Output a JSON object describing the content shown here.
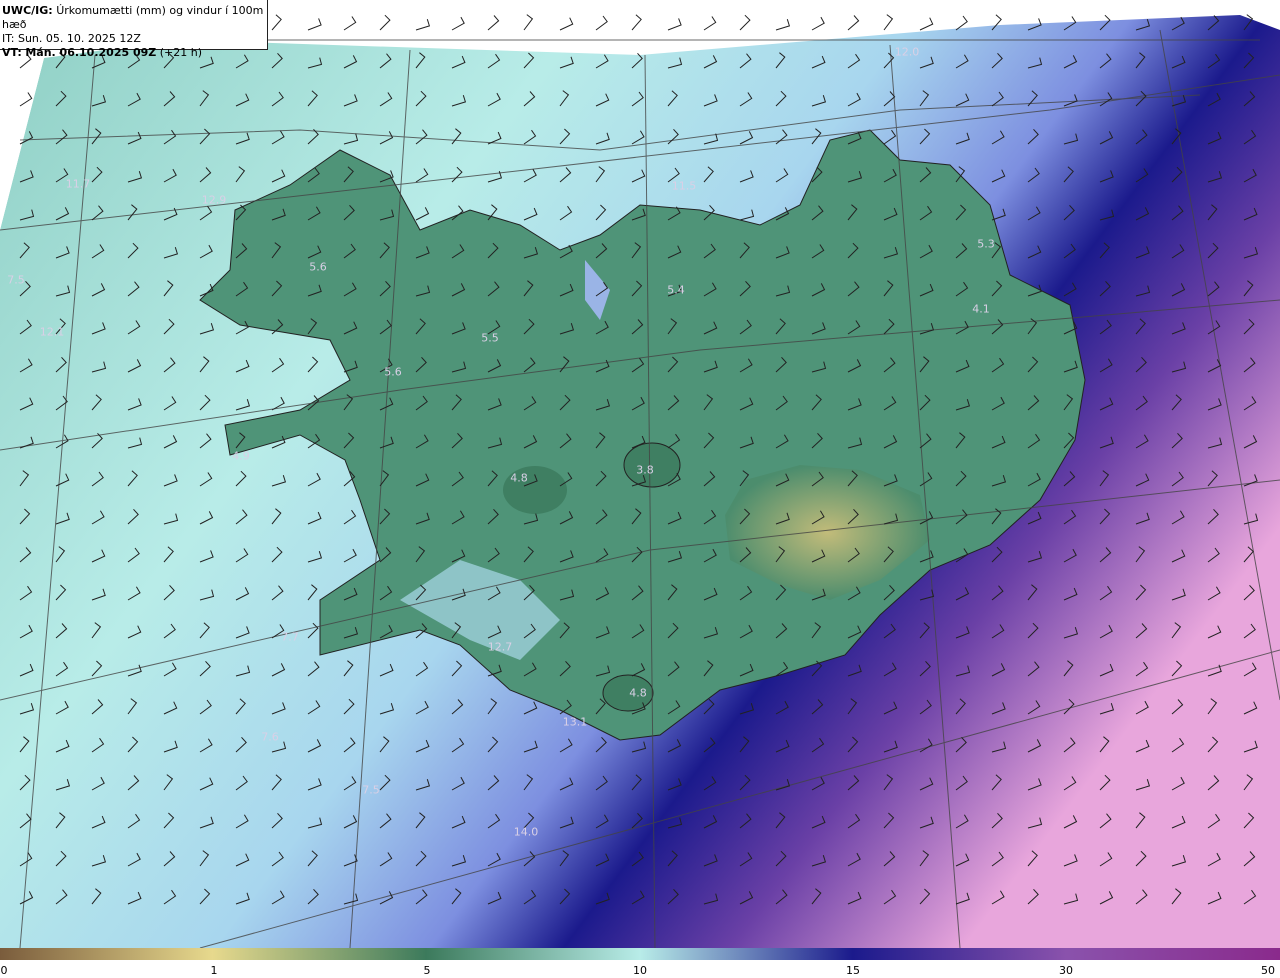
{
  "header": {
    "model_tag": "UWC/IG:",
    "title": "Úrkomumætti (mm) og vindur í 100m hæð",
    "issue_time": "IT: Sun. 05. 10. 2025 12Z",
    "valid_prefix": "VT:",
    "valid_time": "Mán. 06.10.2025 09Z",
    "lead": "(+21 h)"
  },
  "colors": {
    "brown": "#7a5c3c",
    "yellow": "#e7d98d",
    "green_dark": "#3c7a5c",
    "green": "#5e9e80",
    "teal_light": "#b8ece8",
    "blue_light": "#9ab4e6",
    "navy": "#1b1a8c",
    "purple": "#8a52ac",
    "pink": "#e8a6dc"
  },
  "map_labels": [
    {
      "id": "l1",
      "text": "12.0"
    },
    {
      "id": "l2",
      "text": "11.7"
    },
    {
      "id": "l3",
      "text": "12.9"
    },
    {
      "id": "l4",
      "text": "5.6"
    },
    {
      "id": "l5",
      "text": "7.5"
    },
    {
      "id": "l6",
      "text": "12.1"
    },
    {
      "id": "l7",
      "text": "5.6"
    },
    {
      "id": "l8",
      "text": "5.5"
    },
    {
      "id": "l9",
      "text": "5.4"
    },
    {
      "id": "l10",
      "text": "4.1"
    },
    {
      "id": "l11",
      "text": "4.9"
    },
    {
      "id": "l12",
      "text": "4.8"
    },
    {
      "id": "l13",
      "text": "3.8"
    },
    {
      "id": "l14",
      "text": "7.7"
    },
    {
      "id": "l15",
      "text": "12.7"
    },
    {
      "id": "l16",
      "text": "4.8"
    },
    {
      "id": "l17",
      "text": "13.1"
    },
    {
      "id": "l18",
      "text": "7.6"
    },
    {
      "id": "l19",
      "text": "7.5"
    },
    {
      "id": "l20",
      "text": "14.0"
    },
    {
      "id": "l21",
      "text": "11.5"
    },
    {
      "id": "l22",
      "text": "5.3"
    }
  ],
  "colorbar": {
    "ticks": [
      "0",
      "1",
      "5",
      "10",
      "15",
      "30",
      "50"
    ]
  }
}
